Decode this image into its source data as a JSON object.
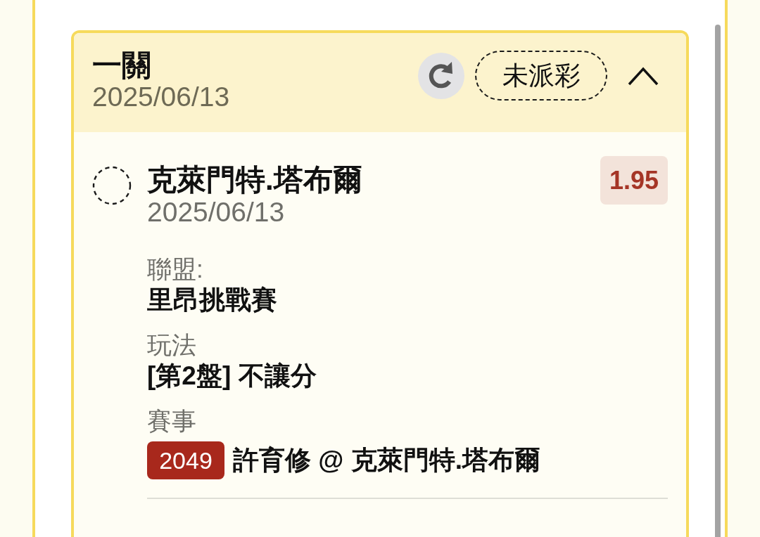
{
  "parlay": {
    "title": "一關",
    "date": "2025/06/13",
    "status": "未派彩",
    "expanded": true
  },
  "selections": [
    {
      "name": "克萊門特.塔布爾",
      "date": "2025/06/13",
      "odds": "1.95",
      "details": [
        {
          "kind": "text",
          "label": "聯盟:",
          "value": "里昂挑戰賽"
        },
        {
          "kind": "text",
          "label": "玩法",
          "value": "[第2盤] 不讓分"
        },
        {
          "kind": "match",
          "label": "賽事",
          "match_no": "2049",
          "value": "許育修 @ 克萊門特.塔布爾"
        }
      ]
    }
  ]
}
